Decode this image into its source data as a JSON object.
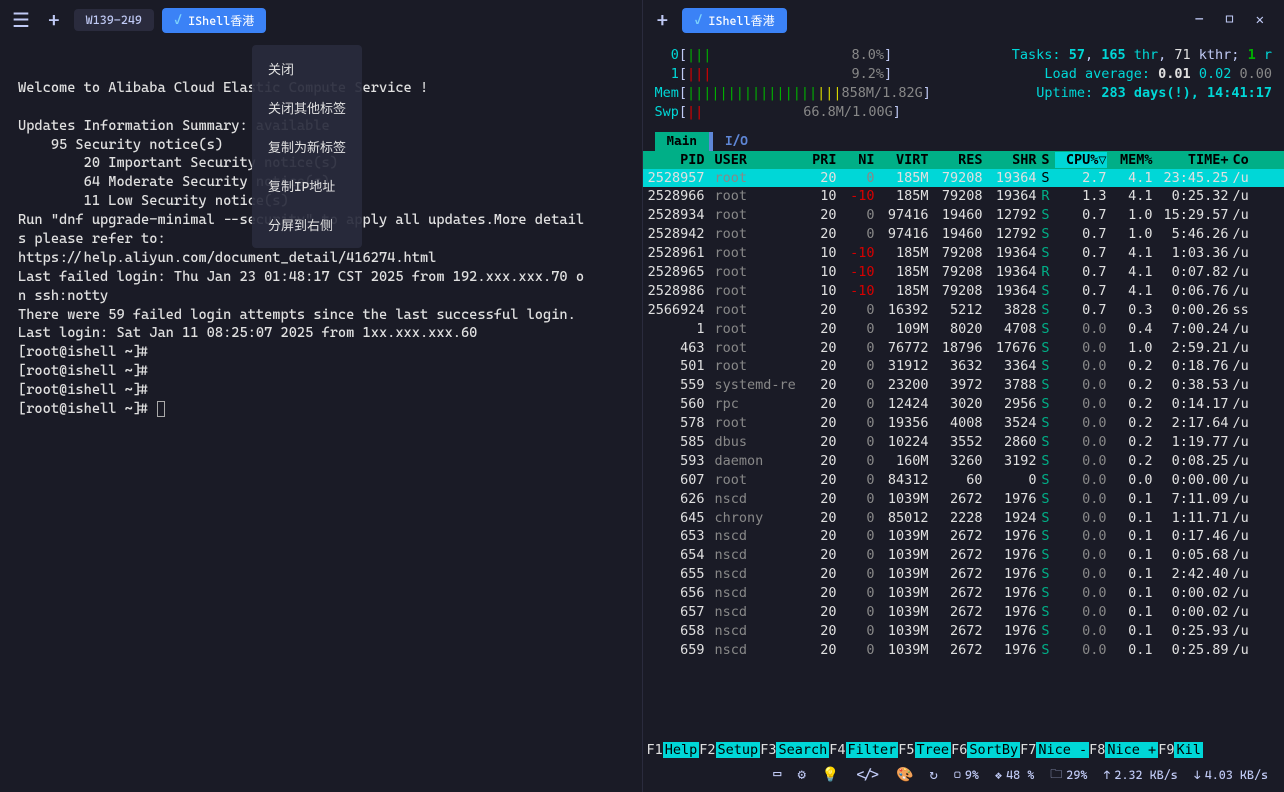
{
  "leftPane": {
    "tabText": "W139-249",
    "tabActive": "IShell香港",
    "contextMenu": [
      "关闭",
      "关闭其他标签",
      "复制为新标签",
      "复制IP地址",
      "分屏到右侧"
    ],
    "terminalLines": [
      "",
      "Welcome to Alibaba Cloud Elastic Compute Service !",
      "",
      "Updates Information Summary: available",
      "    95 Security notice(s)",
      "        20 Important Security notice(s)",
      "        64 Moderate Security notice(s)",
      "        11 Low Security notice(s)",
      "Run \"dnf upgrade-minimal --security\" to apply all updates.More detail",
      "s please refer to:",
      "https://help.aliyun.com/document_detail/416274.html",
      "Last failed login: Thu Jan 23 01:48:17 CST 2025 from 192.xxx.xxx.70 o",
      "n ssh:notty",
      "There were 59 failed login attempts since the last successful login.",
      "Last login: Sat Jan 11 08:25:07 2025 from 1xx.xxx.xxx.60",
      "[root@ishell ~]#",
      "[root@ishell ~]#",
      "[root@ishell ~]#",
      "[root@ishell ~]# "
    ]
  },
  "rightPane": {
    "tabActive": "IShell香港",
    "summary": {
      "cpu0": {
        "label": "0",
        "fill": "|||",
        "pct": "8.0%"
      },
      "cpu1": {
        "label": "1",
        "fill": "|||",
        "pct": "9.2%"
      },
      "mem": {
        "label": "Mem",
        "fill": "||||||||||||||||||||",
        "text": "858M/1.82G"
      },
      "swp": {
        "label": "Swp",
        "fill": "||",
        "text": "66.8M/1.00G"
      },
      "tasks": {
        "label": "Tasks:",
        "v1": "57",
        "v2": "165",
        "thr": "thr,",
        "v3": "71",
        "kthr": "kthr;",
        "v4": "1",
        "r": "r"
      },
      "load": {
        "label": "Load average:",
        "v1": "0.01",
        "v2": "0.02",
        "v3": "0.00"
      },
      "uptime": {
        "label": "Uptime:",
        "v": "283 days(!), 14:41:17"
      }
    },
    "tabs": {
      "main": "Main",
      "io": "I/O"
    },
    "header": {
      "pid": "PID",
      "user": "USER",
      "pri": "PRI",
      "ni": "NI",
      "virt": "VIRT",
      "res": "RES",
      "shr": "SHR",
      "s": "S",
      "cpu": "CPU%▽",
      "mem": "MEM%",
      "time": "TIME+",
      "cmd": "Co"
    },
    "rows": [
      {
        "pid": "2528957",
        "user": "root",
        "pri": "20",
        "ni": "0",
        "virt": "185M",
        "res": "79208",
        "shr": "19364",
        "s": "S",
        "cpu": "2.7",
        "mem": "4.1",
        "time": "23:45.25",
        "cmd": "/u",
        "sel": true
      },
      {
        "pid": "2528966",
        "user": "root",
        "pri": "10",
        "ni": "-10",
        "virt": "185M",
        "res": "79208",
        "shr": "19364",
        "s": "R",
        "cpu": "1.3",
        "mem": "4.1",
        "time": "0:25.32",
        "cmd": "/u"
      },
      {
        "pid": "2528934",
        "user": "root",
        "pri": "20",
        "ni": "0",
        "virt": "97416",
        "res": "19460",
        "shr": "12792",
        "s": "S",
        "cpu": "0.7",
        "mem": "1.0",
        "time": "15:29.57",
        "cmd": "/u"
      },
      {
        "pid": "2528942",
        "user": "root",
        "pri": "20",
        "ni": "0",
        "virt": "97416",
        "res": "19460",
        "shr": "12792",
        "s": "S",
        "cpu": "0.7",
        "mem": "1.0",
        "time": "5:46.26",
        "cmd": "/u"
      },
      {
        "pid": "2528961",
        "user": "root",
        "pri": "10",
        "ni": "-10",
        "virt": "185M",
        "res": "79208",
        "shr": "19364",
        "s": "S",
        "cpu": "0.7",
        "mem": "4.1",
        "time": "1:03.36",
        "cmd": "/u"
      },
      {
        "pid": "2528965",
        "user": "root",
        "pri": "10",
        "ni": "-10",
        "virt": "185M",
        "res": "79208",
        "shr": "19364",
        "s": "R",
        "cpu": "0.7",
        "mem": "4.1",
        "time": "0:07.82",
        "cmd": "/u"
      },
      {
        "pid": "2528986",
        "user": "root",
        "pri": "10",
        "ni": "-10",
        "virt": "185M",
        "res": "79208",
        "shr": "19364",
        "s": "S",
        "cpu": "0.7",
        "mem": "4.1",
        "time": "0:06.76",
        "cmd": "/u"
      },
      {
        "pid": "2566924",
        "user": "root",
        "pri": "20",
        "ni": "0",
        "virt": "16392",
        "res": "5212",
        "shr": "3828",
        "s": "S",
        "cpu": "0.7",
        "mem": "0.3",
        "time": "0:00.26",
        "cmd": "ss"
      },
      {
        "pid": "1",
        "user": "root",
        "pri": "20",
        "ni": "0",
        "virt": "109M",
        "res": "8020",
        "shr": "4708",
        "s": "S",
        "cpu": "0.0",
        "mem": "0.4",
        "time": "7:00.24",
        "cmd": "/u"
      },
      {
        "pid": "463",
        "user": "root",
        "pri": "20",
        "ni": "0",
        "virt": "76772",
        "res": "18796",
        "shr": "17676",
        "s": "S",
        "cpu": "0.0",
        "mem": "1.0",
        "time": "2:59.21",
        "cmd": "/u"
      },
      {
        "pid": "501",
        "user": "root",
        "pri": "20",
        "ni": "0",
        "virt": "31912",
        "res": "3632",
        "shr": "3364",
        "s": "S",
        "cpu": "0.0",
        "mem": "0.2",
        "time": "0:18.76",
        "cmd": "/u"
      },
      {
        "pid": "559",
        "user": "systemd-re",
        "pri": "20",
        "ni": "0",
        "virt": "23200",
        "res": "3972",
        "shr": "3788",
        "s": "S",
        "cpu": "0.0",
        "mem": "0.2",
        "time": "0:38.53",
        "cmd": "/u"
      },
      {
        "pid": "560",
        "user": "rpc",
        "pri": "20",
        "ni": "0",
        "virt": "12424",
        "res": "3020",
        "shr": "2956",
        "s": "S",
        "cpu": "0.0",
        "mem": "0.2",
        "time": "0:14.17",
        "cmd": "/u"
      },
      {
        "pid": "578",
        "user": "root",
        "pri": "20",
        "ni": "0",
        "virt": "19356",
        "res": "4008",
        "shr": "3524",
        "s": "S",
        "cpu": "0.0",
        "mem": "0.2",
        "time": "2:17.64",
        "cmd": "/u"
      },
      {
        "pid": "585",
        "user": "dbus",
        "pri": "20",
        "ni": "0",
        "virt": "10224",
        "res": "3552",
        "shr": "2860",
        "s": "S",
        "cpu": "0.0",
        "mem": "0.2",
        "time": "1:19.77",
        "cmd": "/u"
      },
      {
        "pid": "593",
        "user": "daemon",
        "pri": "20",
        "ni": "0",
        "virt": "160M",
        "res": "3260",
        "shr": "3192",
        "s": "S",
        "cpu": "0.0",
        "mem": "0.2",
        "time": "0:08.25",
        "cmd": "/u"
      },
      {
        "pid": "607",
        "user": "root",
        "pri": "20",
        "ni": "0",
        "virt": "84312",
        "res": "60",
        "shr": "0",
        "s": "S",
        "cpu": "0.0",
        "mem": "0.0",
        "time": "0:00.00",
        "cmd": "/u"
      },
      {
        "pid": "626",
        "user": "nscd",
        "pri": "20",
        "ni": "0",
        "virt": "1039M",
        "res": "2672",
        "shr": "1976",
        "s": "S",
        "cpu": "0.0",
        "mem": "0.1",
        "time": "7:11.09",
        "cmd": "/u"
      },
      {
        "pid": "645",
        "user": "chrony",
        "pri": "20",
        "ni": "0",
        "virt": "85012",
        "res": "2228",
        "shr": "1924",
        "s": "S",
        "cpu": "0.0",
        "mem": "0.1",
        "time": "1:11.71",
        "cmd": "/u"
      },
      {
        "pid": "653",
        "user": "nscd",
        "pri": "20",
        "ni": "0",
        "virt": "1039M",
        "res": "2672",
        "shr": "1976",
        "s": "S",
        "cpu": "0.0",
        "mem": "0.1",
        "time": "0:17.46",
        "cmd": "/u"
      },
      {
        "pid": "654",
        "user": "nscd",
        "pri": "20",
        "ni": "0",
        "virt": "1039M",
        "res": "2672",
        "shr": "1976",
        "s": "S",
        "cpu": "0.0",
        "mem": "0.1",
        "time": "0:05.68",
        "cmd": "/u"
      },
      {
        "pid": "655",
        "user": "nscd",
        "pri": "20",
        "ni": "0",
        "virt": "1039M",
        "res": "2672",
        "shr": "1976",
        "s": "S",
        "cpu": "0.0",
        "mem": "0.1",
        "time": "2:42.40",
        "cmd": "/u"
      },
      {
        "pid": "656",
        "user": "nscd",
        "pri": "20",
        "ni": "0",
        "virt": "1039M",
        "res": "2672",
        "shr": "1976",
        "s": "S",
        "cpu": "0.0",
        "mem": "0.1",
        "time": "0:00.02",
        "cmd": "/u"
      },
      {
        "pid": "657",
        "user": "nscd",
        "pri": "20",
        "ni": "0",
        "virt": "1039M",
        "res": "2672",
        "shr": "1976",
        "s": "S",
        "cpu": "0.0",
        "mem": "0.1",
        "time": "0:00.02",
        "cmd": "/u"
      },
      {
        "pid": "658",
        "user": "nscd",
        "pri": "20",
        "ni": "0",
        "virt": "1039M",
        "res": "2672",
        "shr": "1976",
        "s": "S",
        "cpu": "0.0",
        "mem": "0.1",
        "time": "0:25.93",
        "cmd": "/u"
      },
      {
        "pid": "659",
        "user": "nscd",
        "pri": "20",
        "ni": "0",
        "virt": "1039M",
        "res": "2672",
        "shr": "1976",
        "s": "S",
        "cpu": "0.0",
        "mem": "0.1",
        "time": "0:25.89",
        "cmd": "/u"
      }
    ],
    "footer": [
      {
        "k": "F1",
        "l": "Help "
      },
      {
        "k": "F2",
        "l": "Setup "
      },
      {
        "k": "F3",
        "l": "Search"
      },
      {
        "k": "F4",
        "l": "Filter"
      },
      {
        "k": "F5",
        "l": "Tree  "
      },
      {
        "k": "F6",
        "l": "SortBy"
      },
      {
        "k": "F7",
        "l": "Nice -"
      },
      {
        "k": "F8",
        "l": "Nice +"
      },
      {
        "k": "F9",
        "l": "Kil"
      }
    ]
  },
  "statusbar": {
    "cpu": "9%",
    "mem": "48 %",
    "disk": "29%",
    "up": "2.32 KB/s",
    "down": "4.03 KB/s"
  }
}
